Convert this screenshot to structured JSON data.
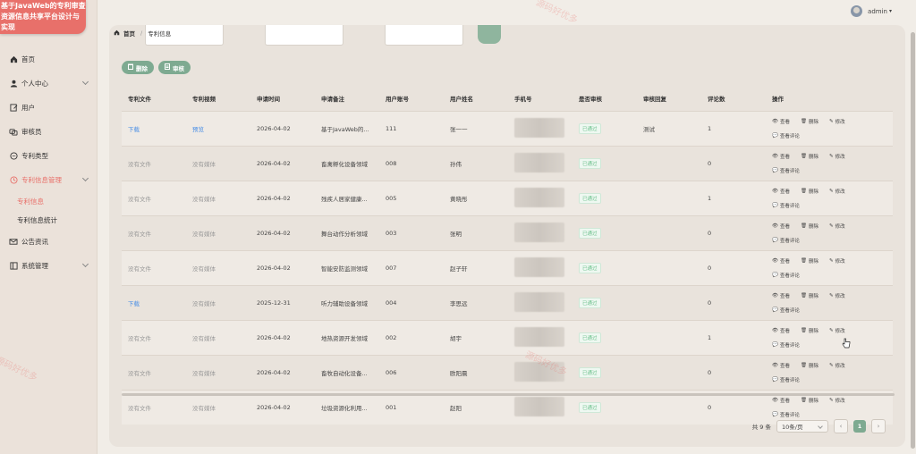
{
  "brand": {
    "title": "基于JavaWeb的专利审查资源信息共享平台设计与实现"
  },
  "user": {
    "name": "admin"
  },
  "breadcrumb": {
    "home": "首页",
    "current": "专利信息"
  },
  "sidebar": {
    "items": [
      {
        "label": "首页",
        "icon": "home-icon"
      },
      {
        "label": "个人中心",
        "icon": "user-icon",
        "expandable": true
      },
      {
        "label": "用户",
        "icon": "edit-icon"
      },
      {
        "label": "审核员",
        "icon": "group-icon"
      },
      {
        "label": "专利类型",
        "icon": "chat-icon"
      },
      {
        "label": "专利信息管理",
        "icon": "clock-icon",
        "expandable": true,
        "active": true
      },
      {
        "label": "公告资讯",
        "icon": "mail-icon"
      },
      {
        "label": "系统管理",
        "icon": "system-icon",
        "expandable": true
      }
    ],
    "sub_items": [
      {
        "label": "专利信息",
        "active": true
      },
      {
        "label": "专利信息统计"
      }
    ]
  },
  "toolbar": {
    "delete_label": "删除",
    "audit_label": "审核"
  },
  "table": {
    "headers": [
      "专利文件",
      "专利视频",
      "申请时间",
      "申请备注",
      "用户账号",
      "用户姓名",
      "手机号",
      "是否审核",
      "审核回复",
      "评论数",
      "操作"
    ],
    "rows": [
      {
        "file": "下载",
        "video": "预览",
        "date": "2026-04-02",
        "note": "基于JavaWeb的...",
        "account": "111",
        "name": "张一一",
        "status": "已通过",
        "reply": "测试",
        "comments": "1"
      },
      {
        "file": "没有文件",
        "video": "没有媒体",
        "date": "2026-04-02",
        "note": "畜禽孵化设备领域",
        "account": "008",
        "name": "孙伟",
        "status": "已通过",
        "reply": "",
        "comments": "0"
      },
      {
        "file": "没有文件",
        "video": "没有媒体",
        "date": "2026-04-02",
        "note": "残疾人居家健康...",
        "account": "005",
        "name": "黄晓彤",
        "status": "已通过",
        "reply": "",
        "comments": "1"
      },
      {
        "file": "没有文件",
        "video": "没有媒体",
        "date": "2026-04-02",
        "note": "舞台动作分析领域",
        "account": "003",
        "name": "张明",
        "status": "已通过",
        "reply": "",
        "comments": "0"
      },
      {
        "file": "没有文件",
        "video": "没有媒体",
        "date": "2026-04-02",
        "note": "智能安防监测领域",
        "account": "007",
        "name": "赵子轩",
        "status": "已通过",
        "reply": "",
        "comments": "0"
      },
      {
        "file": "下载",
        "video": "没有媒体",
        "date": "2025-12-31",
        "note": "听力辅助设备领域",
        "account": "004",
        "name": "李思远",
        "status": "已通过",
        "reply": "",
        "comments": "0"
      },
      {
        "file": "没有文件",
        "video": "没有媒体",
        "date": "2026-04-02",
        "note": "地热资源开发领域",
        "account": "002",
        "name": "胡宇",
        "status": "已通过",
        "reply": "",
        "comments": "1"
      },
      {
        "file": "没有文件",
        "video": "没有媒体",
        "date": "2026-04-02",
        "note": "畜牧自动化设备...",
        "account": "006",
        "name": "欧阳晨",
        "status": "已通过",
        "reply": "",
        "comments": "0"
      },
      {
        "file": "没有文件",
        "video": "没有媒体",
        "date": "2026-04-02",
        "note": "垃圾资源化利用...",
        "account": "001",
        "name": "赵阳",
        "status": "已通过",
        "reply": "",
        "comments": "0"
      }
    ],
    "ops": {
      "view": "查看",
      "delete": "删除",
      "edit": "修改",
      "comments": "查看评论"
    }
  },
  "pagination": {
    "total": "共 9 条",
    "page_size": "10条/页",
    "current": "1",
    "prev": "‹",
    "next": "›"
  },
  "watermark": {
    "text": "源码好优多"
  }
}
